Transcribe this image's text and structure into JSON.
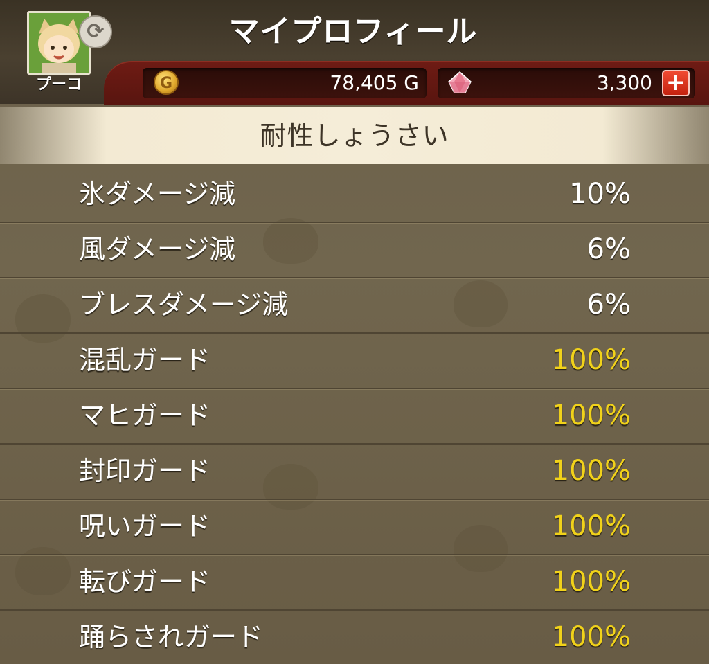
{
  "header": {
    "title": "マイプロフィール",
    "avatar_name": "プーコ",
    "gold": {
      "icon": "gold-coin-icon",
      "glyph": "G",
      "value": "78,405 G"
    },
    "gems": {
      "icon": "gem-icon",
      "value": "3,300",
      "add_label": "+"
    }
  },
  "section": {
    "title": "耐性しょうさい"
  },
  "resistances": [
    {
      "label": "氷ダメージ減",
      "value": "10%",
      "max": false
    },
    {
      "label": "風ダメージ減",
      "value": "6%",
      "max": false
    },
    {
      "label": "ブレスダメージ減",
      "value": "6%",
      "max": false
    },
    {
      "label": "混乱ガード",
      "value": "100%",
      "max": true
    },
    {
      "label": "マヒガード",
      "value": "100%",
      "max": true
    },
    {
      "label": "封印ガード",
      "value": "100%",
      "max": true
    },
    {
      "label": "呪いガード",
      "value": "100%",
      "max": true
    },
    {
      "label": "転びガード",
      "value": "100%",
      "max": true
    },
    {
      "label": "踊らされガード",
      "value": "100%",
      "max": true
    }
  ],
  "colors": {
    "max_value": "#f1d21a",
    "normal_value": "#ffffff",
    "currency_bar": "#6e1b14"
  }
}
